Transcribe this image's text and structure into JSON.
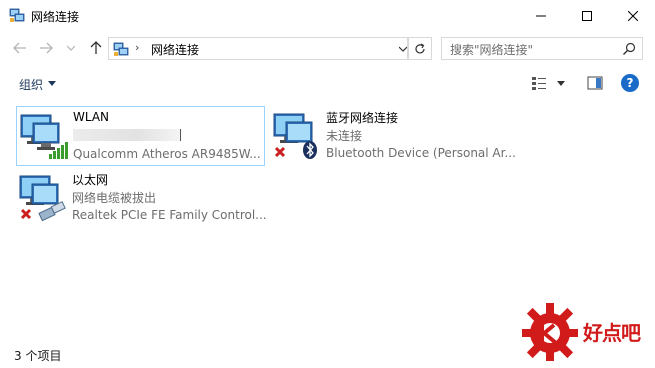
{
  "window": {
    "title": "网络连接",
    "minimize_glyph": "—",
    "maximize_glyph": "☐",
    "close_glyph": "✕"
  },
  "address": {
    "path_label": "网络连接",
    "search_placeholder": "搜索\"网络连接\""
  },
  "toolbar": {
    "organize_label": "组织"
  },
  "connections": [
    {
      "name": "WLAN",
      "status": "",
      "device": "Qualcomm Atheros AR9485W...",
      "icon": "wifi-adapter-icon",
      "selected": true
    },
    {
      "name": "蓝牙网络连接",
      "status": "未连接",
      "device": "Bluetooth Device (Personal Ar...",
      "icon": "bluetooth-adapter-icon",
      "selected": false
    },
    {
      "name": "以太网",
      "status": "网络电缆被拔出",
      "device": "Realtek PCIe FE Family Control...",
      "icon": "ethernet-adapter-icon",
      "selected": false
    }
  ],
  "statusbar": {
    "item_count": "3 个项目"
  },
  "watermark": {
    "text": "好点吧"
  },
  "colors": {
    "accent": "#1a6bc8",
    "selection_border": "#99d1ff",
    "error_red": "#cc1f1f",
    "signal_green": "#3a9c2c"
  }
}
